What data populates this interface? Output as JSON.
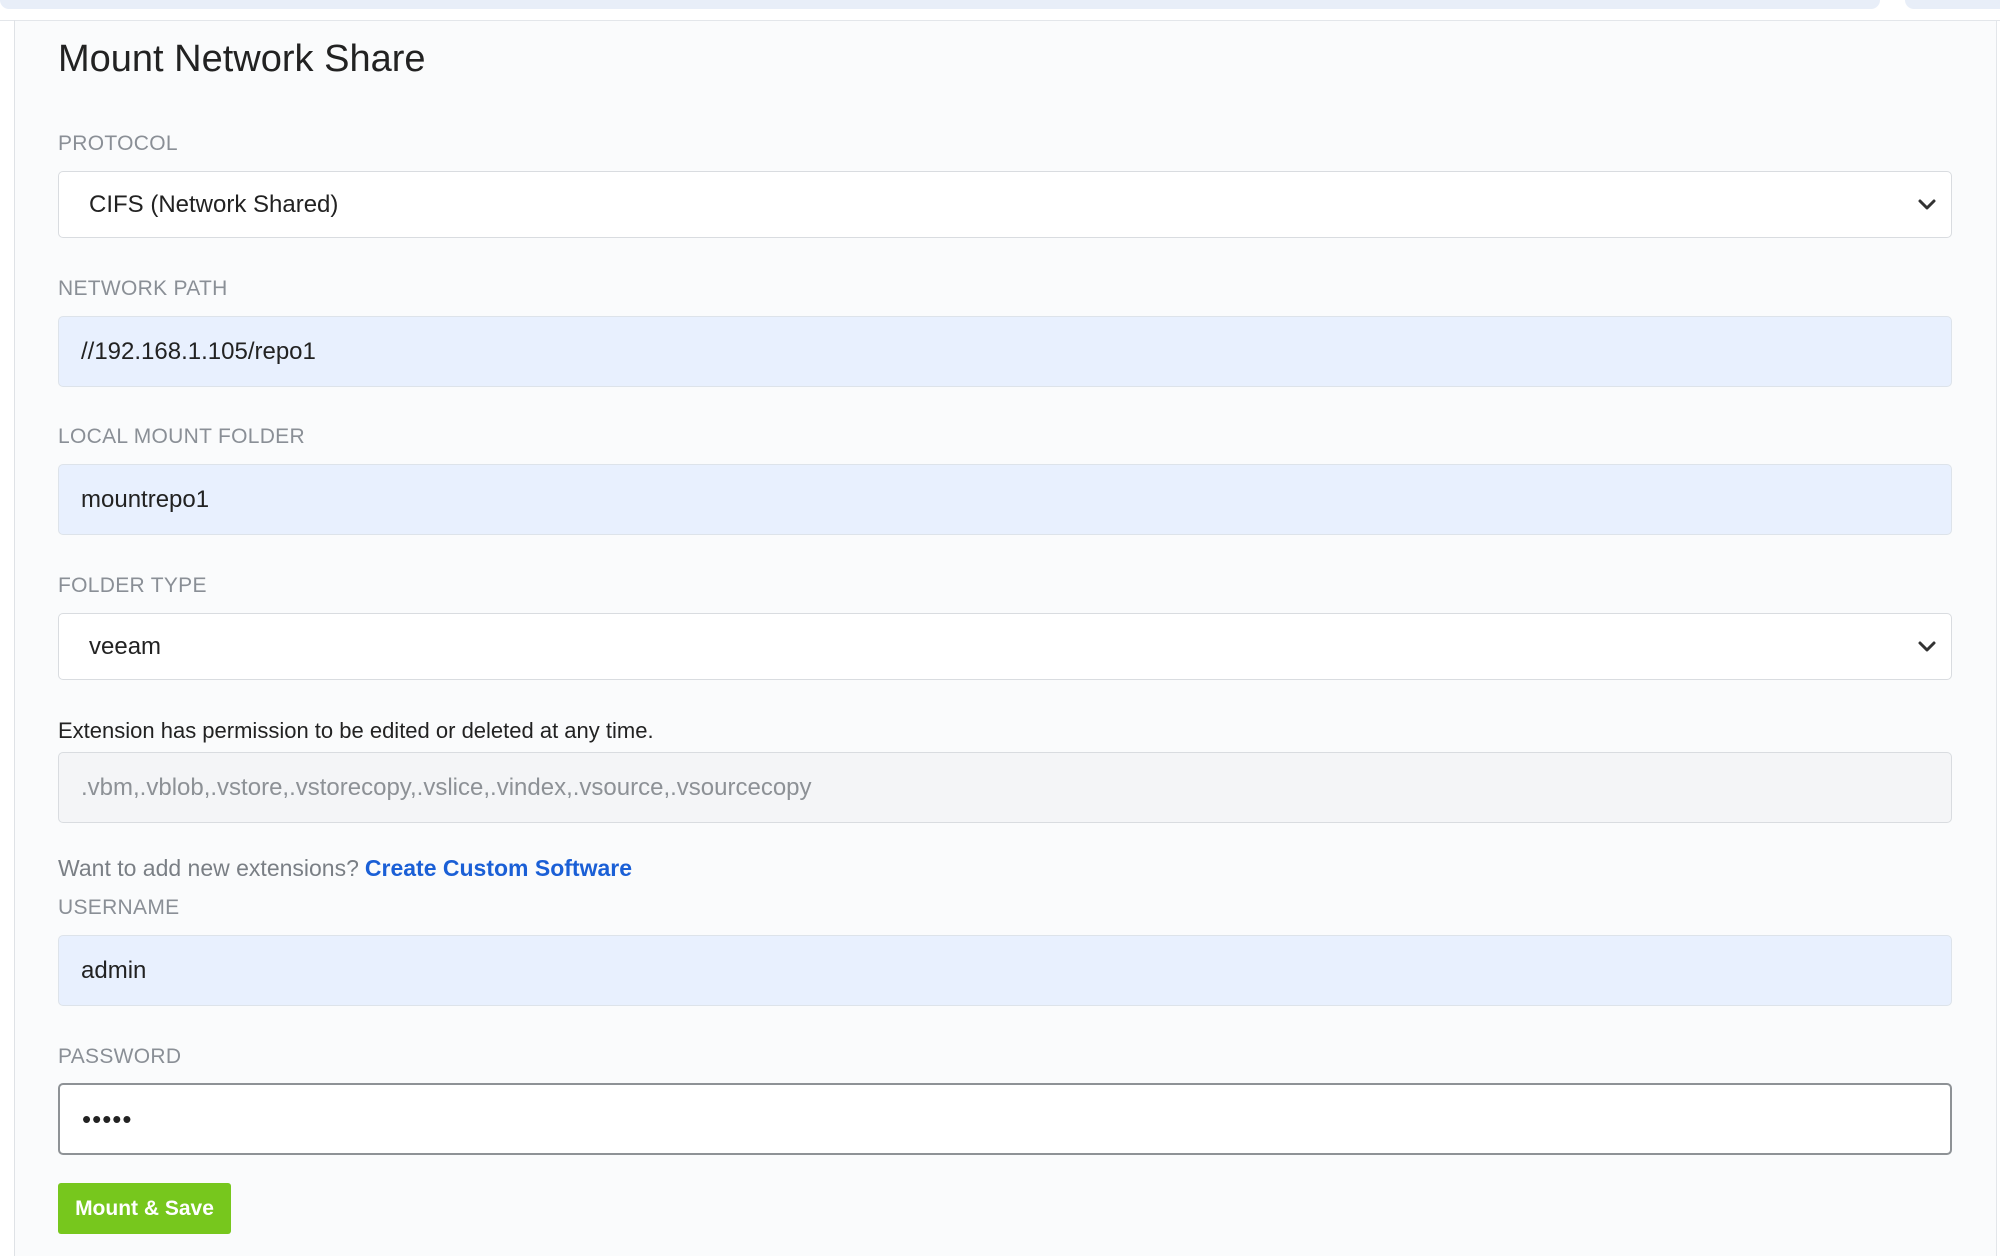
{
  "form": {
    "title": "Mount Network Share",
    "protocol": {
      "label": "PROTOCOL",
      "selected": "CIFS (Network Shared)"
    },
    "network_path": {
      "label": "NETWORK PATH",
      "value": "//192.168.1.105/repo1"
    },
    "local_mount_folder": {
      "label": "LOCAL MOUNT FOLDER",
      "value": "mountrepo1"
    },
    "folder_type": {
      "label": "FOLDER TYPE",
      "selected": "veeam"
    },
    "extensions": {
      "note": "Extension has permission to be edited or deleted at any time.",
      "value": ".vbm,.vblob,.vstore,.vstorecopy,.vslice,.vindex,.vsource,.vsourcecopy"
    },
    "custom_software": {
      "prompt": "Want to add new extensions?",
      "link_label": "Create Custom Software"
    },
    "username": {
      "label": "USERNAME",
      "value": "admin"
    },
    "password": {
      "label": "PASSWORD",
      "value": "•••••"
    },
    "submit_label": "Mount & Save"
  },
  "colors": {
    "accent_button": "#77c71d",
    "link": "#1a5fd6",
    "autofill_background": "#e8f0fe"
  },
  "icons": {
    "dropdown": "chevron-down-icon"
  }
}
